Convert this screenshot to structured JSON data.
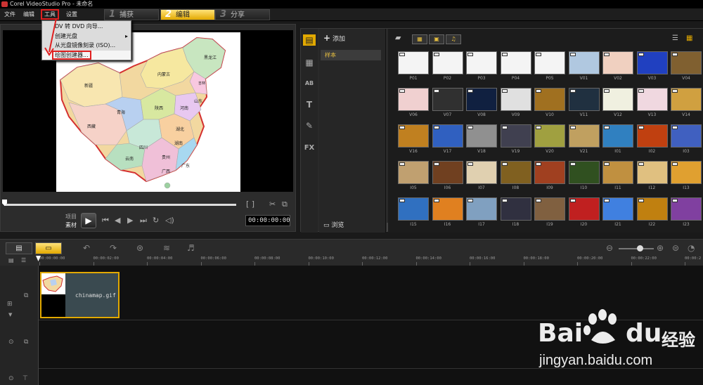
{
  "window": {
    "title": "Corel VideoStudio Pro - 未命名"
  },
  "menu": {
    "file": "文件",
    "edit": "编辑",
    "tools": "工具",
    "settings": "设置"
  },
  "steps": [
    {
      "num": "1",
      "label": "捕获"
    },
    {
      "num": "2",
      "label": "编辑"
    },
    {
      "num": "3",
      "label": "分享"
    }
  ],
  "dropdown": {
    "items": [
      "DV 转 DVD 向导...",
      "创建光盘",
      "从光盘镜像刻录 (ISO)...",
      "绘图创建器..."
    ],
    "submenu_arrow": "▸"
  },
  "preview": {
    "label_project": "项目",
    "label_clip": "素材",
    "timecode": "00:00:00:00",
    "brackets": "[   ]"
  },
  "map": {
    "regions": [
      "黑龙江",
      "吉林",
      "辽宁",
      "内蒙古",
      "新疆",
      "西藏",
      "青海",
      "甘肃",
      "宁夏",
      "四川",
      "云南",
      "贵州",
      "广西",
      "广东",
      "湖南",
      "湖北",
      "河南",
      "山东",
      "河北",
      "山西",
      "陕西",
      "江西",
      "福建",
      "安徽",
      "江苏",
      "浙江",
      "重庆"
    ]
  },
  "library": {
    "add_label": "添加",
    "folder_sample": "样本",
    "browse_label": "浏览",
    "collapse": "«",
    "side_icons": [
      "▦",
      "AB",
      "T",
      "✎",
      "FX"
    ],
    "thumbs_row1": [
      "P01",
      "P02",
      "P03",
      "P04",
      "P05",
      "V01",
      "V02",
      "V03",
      "V04"
    ],
    "thumbs_row2": [
      "V06",
      "V07",
      "V08",
      "V09",
      "V10",
      "V11",
      "V12",
      "V13",
      "V14"
    ],
    "thumbs_row3": [
      "V16",
      "V17",
      "V18",
      "V19",
      "V20",
      "V21",
      "I01",
      "I02",
      "I03"
    ],
    "thumbs_row4": [
      "I05",
      "I06",
      "I07",
      "I08",
      "I09",
      "I10",
      "I11",
      "I12",
      "I13"
    ],
    "thumbs_row5": [
      "I15",
      "I16",
      "I17",
      "I18",
      "I19",
      "I20",
      "I21",
      "I22",
      "I23"
    ]
  },
  "timeline": {
    "ticks": [
      "00:00:00:00",
      "00:00:02:00",
      "00:00:04:00",
      "00:00:06:00",
      "00:00:08:00",
      "00:00:10:00",
      "00:00:12:00",
      "00:00:14:00",
      "00:00:16:00",
      "00:00:18:00",
      "00:00:20:00",
      "00:00:22:00",
      "00:00:2"
    ],
    "clip_name": "chinamap.gif"
  },
  "watermark": {
    "bai": "Bai",
    "du": "du",
    "jingyan": "经验",
    "url": "jingyan.baidu.com"
  },
  "colors": {
    "accent": "#e2a900",
    "highlight_box": "#e02020",
    "panel": "#2a2a2a"
  }
}
